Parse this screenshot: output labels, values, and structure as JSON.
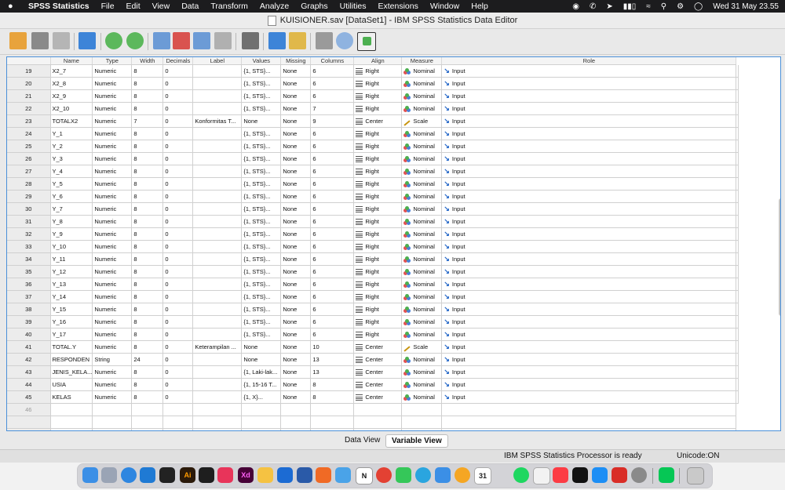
{
  "menubar": {
    "app_name": "SPSS Statistics",
    "menus": [
      "File",
      "Edit",
      "View",
      "Data",
      "Transform",
      "Analyze",
      "Graphs",
      "Utilities",
      "Extensions",
      "Window",
      "Help"
    ],
    "datetime": "Wed 31 May  23.55"
  },
  "window": {
    "title": "KUISIONER.sav [DataSet1] - IBM SPSS Statistics Data Editor"
  },
  "grid": {
    "headers": {
      "name": "Name",
      "type": "Type",
      "width": "Width",
      "decimals": "Decimals",
      "label": "Label",
      "values": "Values",
      "missing": "Missing",
      "columns": "Columns",
      "align": "Align",
      "measure": "Measure",
      "role": "Role"
    },
    "rows": [
      {
        "n": "19",
        "name": "X2_7",
        "type": "Numeric",
        "width": "8",
        "decimals": "0",
        "label": "",
        "values": "{1, STS}...",
        "missing": "None",
        "columns": "6",
        "align": "Right",
        "measure": "Nominal",
        "role": "Input"
      },
      {
        "n": "20",
        "name": "X2_8",
        "type": "Numeric",
        "width": "8",
        "decimals": "0",
        "label": "",
        "values": "{1, STS}...",
        "missing": "None",
        "columns": "6",
        "align": "Right",
        "measure": "Nominal",
        "role": "Input"
      },
      {
        "n": "21",
        "name": "X2_9",
        "type": "Numeric",
        "width": "8",
        "decimals": "0",
        "label": "",
        "values": "{1, STS}...",
        "missing": "None",
        "columns": "6",
        "align": "Right",
        "measure": "Nominal",
        "role": "Input"
      },
      {
        "n": "22",
        "name": "X2_10",
        "type": "Numeric",
        "width": "8",
        "decimals": "0",
        "label": "",
        "values": "{1, STS}...",
        "missing": "None",
        "columns": "7",
        "align": "Right",
        "measure": "Nominal",
        "role": "Input"
      },
      {
        "n": "23",
        "name": "TOTALX2",
        "type": "Numeric",
        "width": "7",
        "decimals": "0",
        "label": "Konformitas T...",
        "values": "None",
        "missing": "None",
        "columns": "9",
        "align": "Center",
        "measure": "Scale",
        "role": "Input"
      },
      {
        "n": "24",
        "name": "Y_1",
        "type": "Numeric",
        "width": "8",
        "decimals": "0",
        "label": "",
        "values": "{1, STS}...",
        "missing": "None",
        "columns": "6",
        "align": "Right",
        "measure": "Nominal",
        "role": "Input"
      },
      {
        "n": "25",
        "name": "Y_2",
        "type": "Numeric",
        "width": "8",
        "decimals": "0",
        "label": "",
        "values": "{1, STS}...",
        "missing": "None",
        "columns": "6",
        "align": "Right",
        "measure": "Nominal",
        "role": "Input"
      },
      {
        "n": "26",
        "name": "Y_3",
        "type": "Numeric",
        "width": "8",
        "decimals": "0",
        "label": "",
        "values": "{1, STS}...",
        "missing": "None",
        "columns": "6",
        "align": "Right",
        "measure": "Nominal",
        "role": "Input"
      },
      {
        "n": "27",
        "name": "Y_4",
        "type": "Numeric",
        "width": "8",
        "decimals": "0",
        "label": "",
        "values": "{1, STS}...",
        "missing": "None",
        "columns": "6",
        "align": "Right",
        "measure": "Nominal",
        "role": "Input"
      },
      {
        "n": "28",
        "name": "Y_5",
        "type": "Numeric",
        "width": "8",
        "decimals": "0",
        "label": "",
        "values": "{1, STS}...",
        "missing": "None",
        "columns": "6",
        "align": "Right",
        "measure": "Nominal",
        "role": "Input"
      },
      {
        "n": "29",
        "name": "Y_6",
        "type": "Numeric",
        "width": "8",
        "decimals": "0",
        "label": "",
        "values": "{1, STS}...",
        "missing": "None",
        "columns": "6",
        "align": "Right",
        "measure": "Nominal",
        "role": "Input"
      },
      {
        "n": "30",
        "name": "Y_7",
        "type": "Numeric",
        "width": "8",
        "decimals": "0",
        "label": "",
        "values": "{1, STS}...",
        "missing": "None",
        "columns": "6",
        "align": "Right",
        "measure": "Nominal",
        "role": "Input"
      },
      {
        "n": "31",
        "name": "Y_8",
        "type": "Numeric",
        "width": "8",
        "decimals": "0",
        "label": "",
        "values": "{1, STS}...",
        "missing": "None",
        "columns": "6",
        "align": "Right",
        "measure": "Nominal",
        "role": "Input"
      },
      {
        "n": "32",
        "name": "Y_9",
        "type": "Numeric",
        "width": "8",
        "decimals": "0",
        "label": "",
        "values": "{1, STS}...",
        "missing": "None",
        "columns": "6",
        "align": "Right",
        "measure": "Nominal",
        "role": "Input"
      },
      {
        "n": "33",
        "name": "Y_10",
        "type": "Numeric",
        "width": "8",
        "decimals": "0",
        "label": "",
        "values": "{1, STS}...",
        "missing": "None",
        "columns": "6",
        "align": "Right",
        "measure": "Nominal",
        "role": "Input"
      },
      {
        "n": "34",
        "name": "Y_11",
        "type": "Numeric",
        "width": "8",
        "decimals": "0",
        "label": "",
        "values": "{1, STS}...",
        "missing": "None",
        "columns": "6",
        "align": "Right",
        "measure": "Nominal",
        "role": "Input"
      },
      {
        "n": "35",
        "name": "Y_12",
        "type": "Numeric",
        "width": "8",
        "decimals": "0",
        "label": "",
        "values": "{1, STS}...",
        "missing": "None",
        "columns": "6",
        "align": "Right",
        "measure": "Nominal",
        "role": "Input"
      },
      {
        "n": "36",
        "name": "Y_13",
        "type": "Numeric",
        "width": "8",
        "decimals": "0",
        "label": "",
        "values": "{1, STS}...",
        "missing": "None",
        "columns": "6",
        "align": "Right",
        "measure": "Nominal",
        "role": "Input"
      },
      {
        "n": "37",
        "name": "Y_14",
        "type": "Numeric",
        "width": "8",
        "decimals": "0",
        "label": "",
        "values": "{1, STS}...",
        "missing": "None",
        "columns": "6",
        "align": "Right",
        "measure": "Nominal",
        "role": "Input"
      },
      {
        "n": "38",
        "name": "Y_15",
        "type": "Numeric",
        "width": "8",
        "decimals": "0",
        "label": "",
        "values": "{1, STS}...",
        "missing": "None",
        "columns": "6",
        "align": "Right",
        "measure": "Nominal",
        "role": "Input"
      },
      {
        "n": "39",
        "name": "Y_16",
        "type": "Numeric",
        "width": "8",
        "decimals": "0",
        "label": "",
        "values": "{1, STS}...",
        "missing": "None",
        "columns": "6",
        "align": "Right",
        "measure": "Nominal",
        "role": "Input"
      },
      {
        "n": "40",
        "name": "Y_17",
        "type": "Numeric",
        "width": "8",
        "decimals": "0",
        "label": "",
        "values": "{1, STS}...",
        "missing": "None",
        "columns": "6",
        "align": "Right",
        "measure": "Nominal",
        "role": "Input"
      },
      {
        "n": "41",
        "name": "TOTAL.Y",
        "type": "Numeric",
        "width": "8",
        "decimals": "0",
        "label": "Keterampilan ...",
        "values": "None",
        "missing": "None",
        "columns": "10",
        "align": "Center",
        "measure": "Scale",
        "role": "Input"
      },
      {
        "n": "42",
        "name": "RESPONDEN",
        "type": "String",
        "width": "24",
        "decimals": "0",
        "label": "",
        "values": "None",
        "missing": "None",
        "columns": "13",
        "align": "Center",
        "measure": "Nominal",
        "role": "Input"
      },
      {
        "n": "43",
        "name": "JENIS_KELA...",
        "type": "Numeric",
        "width": "8",
        "decimals": "0",
        "label": "",
        "values": "{1, Laki-lak...",
        "missing": "None",
        "columns": "13",
        "align": "Center",
        "measure": "Nominal",
        "role": "Input"
      },
      {
        "n": "44",
        "name": "USIA",
        "type": "Numeric",
        "width": "8",
        "decimals": "0",
        "label": "",
        "values": "{1, 15-16 T...",
        "missing": "None",
        "columns": "8",
        "align": "Center",
        "measure": "Nominal",
        "role": "Input"
      },
      {
        "n": "45",
        "name": "KELAS",
        "type": "Numeric",
        "width": "8",
        "decimals": "0",
        "label": "",
        "values": "{1, X}...",
        "missing": "None",
        "columns": "8",
        "align": "Center",
        "measure": "Nominal",
        "role": "Input"
      }
    ],
    "empty_row": "46"
  },
  "tabs": {
    "data_view": "Data View",
    "variable_view": "Variable View",
    "active": "Variable View"
  },
  "status": {
    "processor": "IBM SPSS Statistics Processor is ready",
    "encoding": "Unicode:ON"
  },
  "colors": {
    "accent": "#4a90d9",
    "menubar": "#1c1c1e",
    "role_icon": "#1f63c6",
    "scale_icon": "#c89510"
  },
  "dock_icons": [
    "finder-icon",
    "launchpad-icon",
    "safari-icon",
    "vscode-icon",
    "terminal-icon",
    "illustrator-icon",
    "figma-icon",
    "creative-cloud-icon",
    "xd-icon",
    "spss-icon",
    "xcode-icon",
    "swift-icon",
    "app-icon",
    "globe-icon",
    "notion-icon",
    "chrome-icon",
    "facetime-icon",
    "telegram-icon",
    "mail-icon",
    "photos-icon",
    "calendar-icon",
    "spotify-icon",
    "activity-monitor-icon",
    "music-icon",
    "apple-tv-icon",
    "app-store-icon",
    "wps-icon",
    "system-preferences-icon",
    "line-icon",
    "trash-icon"
  ],
  "calendar_day": "31"
}
